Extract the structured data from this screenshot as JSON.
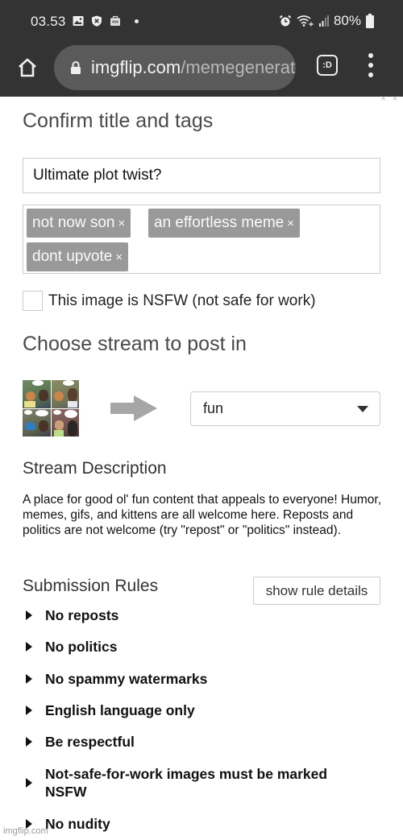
{
  "status_bar": {
    "time": "03.53",
    "left_icons": [
      "gallery-icon",
      "shield-x-icon",
      "briefcase-icon",
      "notification-dot-icon"
    ],
    "right_icons": [
      "alarm-icon",
      "wifi-icon",
      "signal-icon",
      "battery-icon"
    ],
    "battery_percent": "80%"
  },
  "browser": {
    "url_domain": "imgflip.com",
    "url_path": "/memegenerator",
    "tab_switcher_label": ":D",
    "home_icon": "home-icon",
    "lock_icon": "lock-icon",
    "menu_icon": "more-vert-icon"
  },
  "form": {
    "confirm_heading": "Confirm title and tags",
    "title_value": "Ultimate plot twist?",
    "tags": [
      {
        "label": "not now son",
        "remove": "×"
      },
      {
        "label": "an effortless meme",
        "remove": "×"
      },
      {
        "label": "dont upvote",
        "remove": "×"
      }
    ],
    "nsfw_label": "This image is NSFW (not safe for work)",
    "nsfw_checked": false,
    "stream_heading": "Choose stream to post in",
    "stream_selected": "fun",
    "stream_description_heading": "Stream Description",
    "stream_description": "A place for good ol' fun content that appeals to everyone! Humor, memes, gifs, and kittens are all welcome here. Reposts and politics are not welcome (try \"repost\" or \"politics\" instead).",
    "rules_heading": "Submission Rules",
    "show_rule_details": "show rule details",
    "rules": [
      "No reposts",
      "No politics",
      "No spammy watermarks",
      "English language only",
      "Be respectful",
      "Not-safe-for-work images must be marked NSFW",
      "No nudity"
    ]
  },
  "watermark": "imgflip.com",
  "colors": {
    "chrome_bg": "#333333",
    "url_pill": "#5a5a5a",
    "tag_bg": "#999999",
    "border": "#cccccc"
  }
}
